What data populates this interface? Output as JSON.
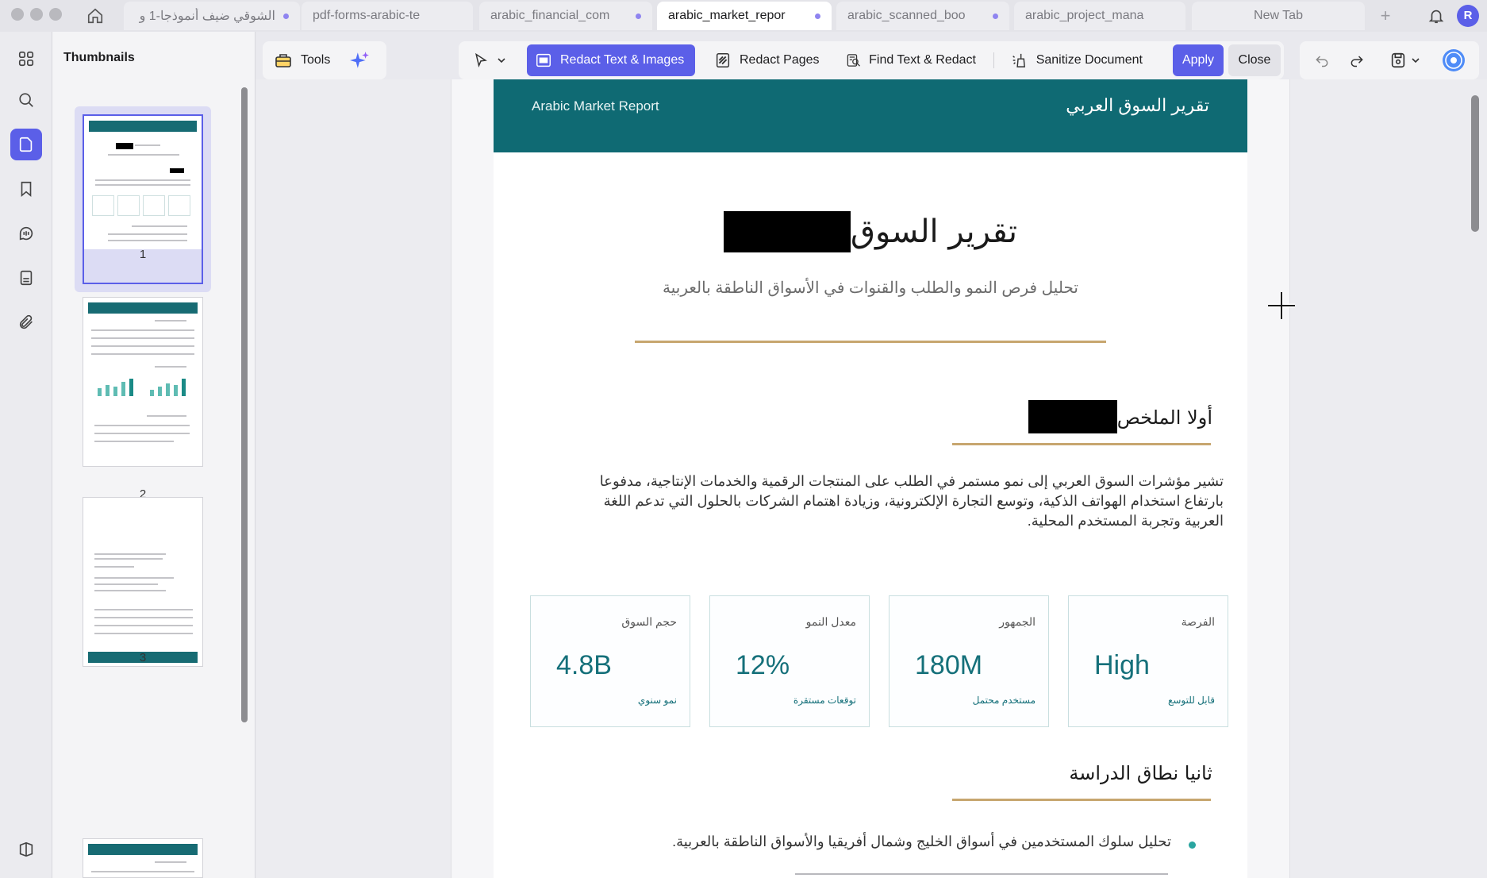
{
  "tabs": [
    {
      "label": "الشوقي ضيف أنموذجا-1 و",
      "modified": true
    },
    {
      "label": "pdf-forms-arabic-te",
      "modified": false
    },
    {
      "label": "arabic_financial_com",
      "modified": true
    },
    {
      "label": "arabic_market_repor",
      "modified": true,
      "active": true
    },
    {
      "label": "arabic_scanned_boo",
      "modified": true
    },
    {
      "label": "arabic_project_mana",
      "modified": false
    },
    {
      "label": "New Tab",
      "modified": false
    }
  ],
  "user_initial": "R",
  "sidebar": {
    "title": "Thumbnails",
    "pages": [
      "1",
      "2",
      "3"
    ]
  },
  "toolbar": {
    "tools_label": "Tools",
    "redact_text_images": "Redact Text & Images",
    "redact_pages": "Redact Pages",
    "find_text_redact": "Find Text & Redact",
    "sanitize_document": "Sanitize Document",
    "apply": "Apply",
    "close": "Close"
  },
  "document": {
    "header_en": "Arabic Market Report",
    "header_ar": "تقرير السوق العربي",
    "title_visible": "تقرير السوق",
    "subtitle": "تحليل فرص النمو والطلب والقنوات في الأسواق الناطقة بالعربية",
    "section1_title": "أولا الملخص",
    "section1_para": "تشير مؤشرات السوق العربي إلى نمو مستمر في الطلب على المنتجات الرقمية والخدمات الإنتاجية، مدفوعا بارتفاع استخدام الهواتف الذكية، وتوسع التجارة الإلكترونية، وزيادة اهتمام الشركات بالحلول التي تدعم اللغة العربية وتجربة المستخدم المحلية.",
    "kpis": [
      {
        "label": "حجم السوق",
        "value": "4.8B",
        "foot": "نمو سنوي"
      },
      {
        "label": "معدل النمو",
        "value": "12%",
        "foot": "توقعات مستقرة"
      },
      {
        "label": "الجمهور",
        "value": "180M",
        "foot": "مستخدم محتمل"
      },
      {
        "label": "الفرصة",
        "value": "High",
        "foot": "قابل للتوسع"
      }
    ],
    "section2_title": "ثانيا نطاق الدراسة",
    "bullets": [
      "تحليل سلوك المستخدمين في أسواق الخليج وشمال أفريقيا والأسواق الناطقة بالعربية."
    ]
  },
  "colors": {
    "accent": "#5b5fe8",
    "header_teal": "#0f6a73",
    "gold_rule": "#c7a66f",
    "kpi_value": "#15707a"
  }
}
